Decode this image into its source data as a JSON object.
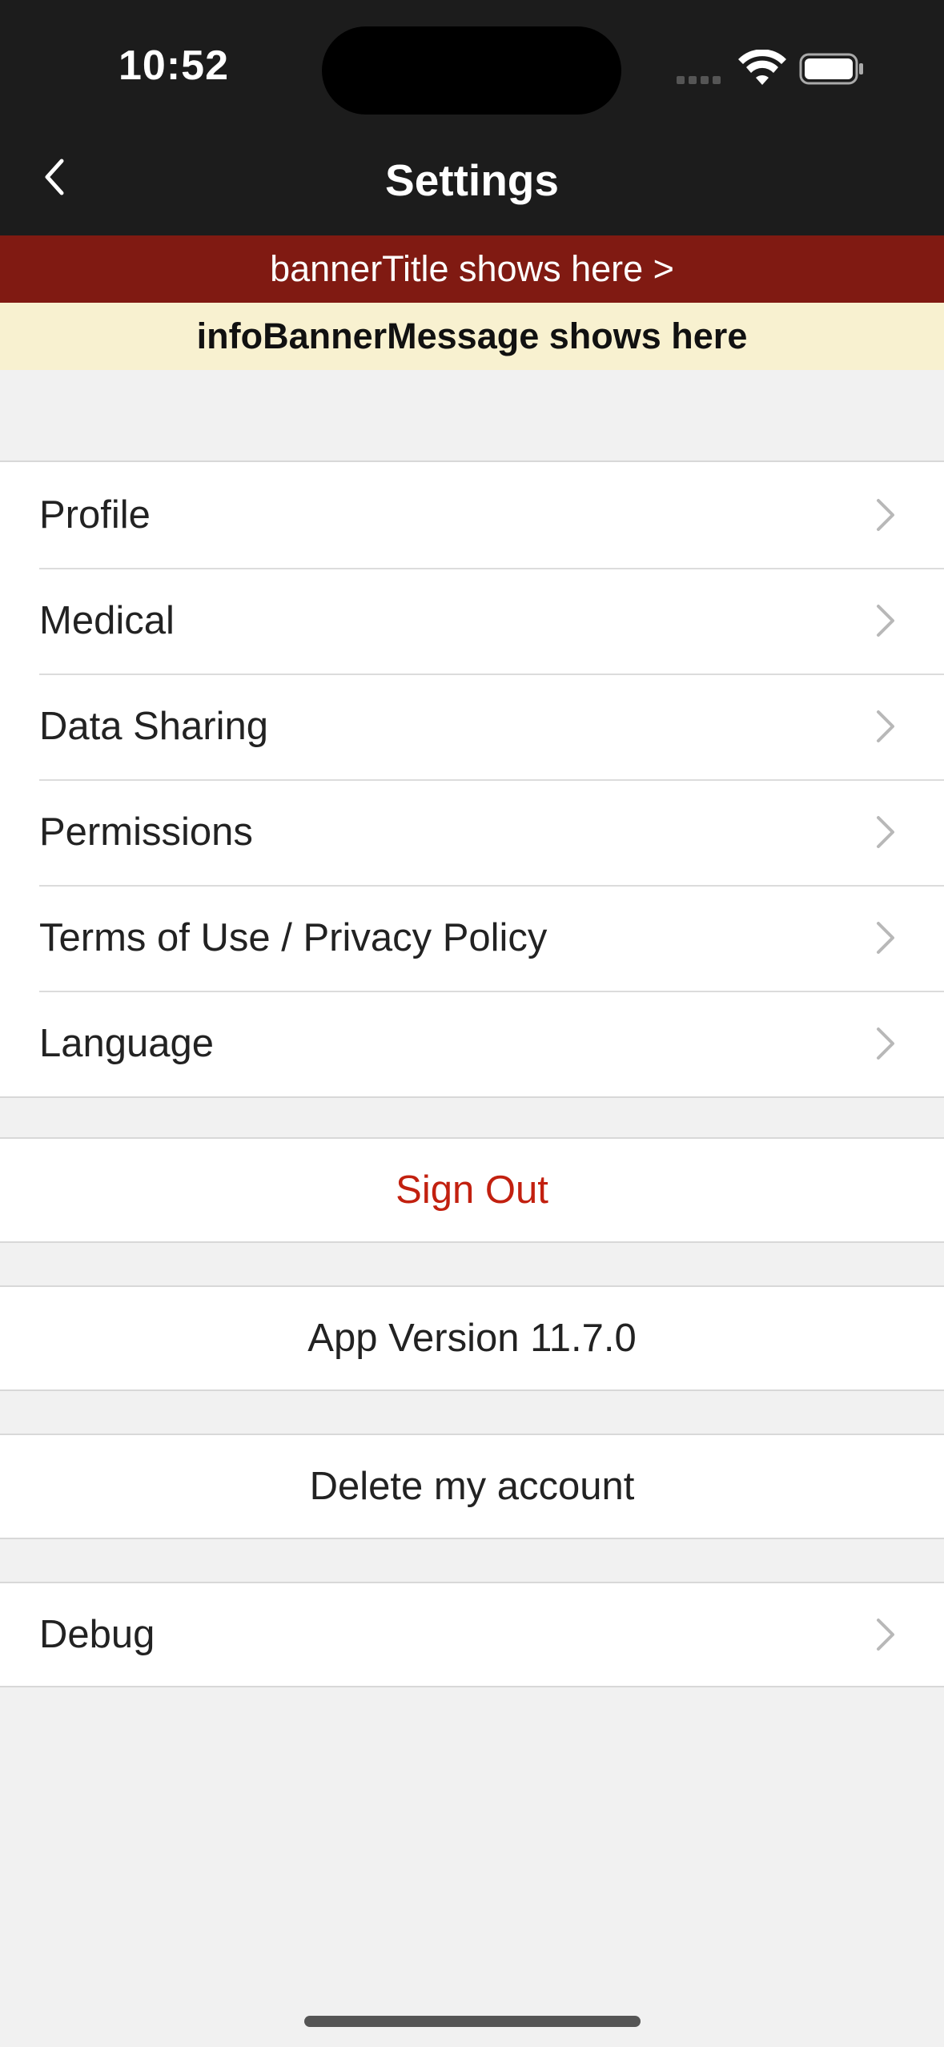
{
  "status_bar": {
    "time": "10:52"
  },
  "nav": {
    "title": "Settings"
  },
  "banners": {
    "banner_title": "bannerTitle shows here  >",
    "info_message": "infoBannerMessage shows here"
  },
  "menu": {
    "items": [
      {
        "label": "Profile"
      },
      {
        "label": "Medical"
      },
      {
        "label": "Data Sharing"
      },
      {
        "label": "Permissions"
      },
      {
        "label": "Terms of Use / Privacy Policy"
      },
      {
        "label": "Language"
      }
    ]
  },
  "actions": {
    "sign_out": "Sign Out",
    "app_version": "App Version 11.7.0",
    "delete_account": "Delete my account",
    "debug": "Debug"
  },
  "colors": {
    "nav_bg": "#1c1c1c",
    "banner_bg": "#801a12",
    "info_bg": "#f8f1d0",
    "sign_out_text": "#c2200f"
  }
}
